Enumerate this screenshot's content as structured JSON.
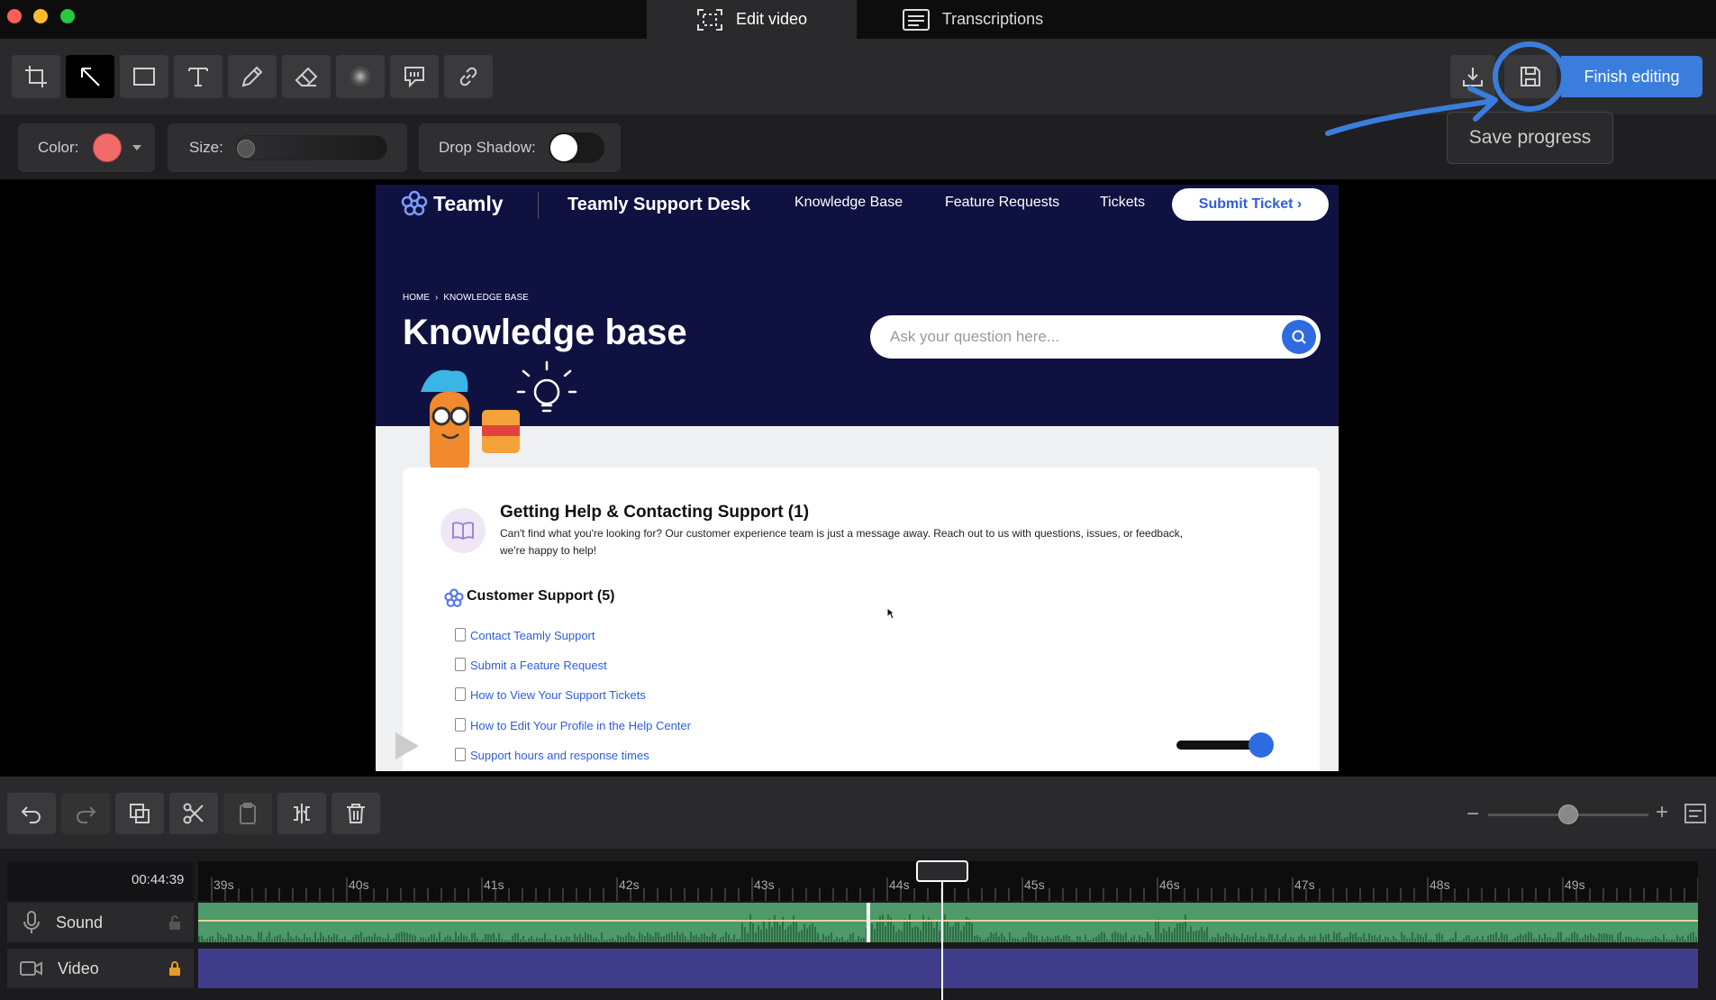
{
  "window": {
    "tabs": [
      {
        "label": "Edit video",
        "icon": "crop-frame-icon",
        "active": true
      },
      {
        "label": "Transcriptions",
        "icon": "transcript-icon",
        "active": false
      }
    ],
    "traffic_lights": {
      "close": "#ff5f57",
      "minimize": "#febc2e",
      "maximize": "#28c840"
    }
  },
  "toolbar": {
    "tools": [
      "crop-icon",
      "arrow-icon",
      "rectangle-icon",
      "text-icon",
      "pen-icon",
      "eraser-icon",
      "blur-icon",
      "callout-icon",
      "link-icon"
    ],
    "selected_tool": "arrow-icon",
    "finish_label": "Finish editing",
    "save_tooltip": "Save progress",
    "accent": "#3b7ddd"
  },
  "options": {
    "color_label": "Color:",
    "color_value": "#f26b6b",
    "size_label": "Size:",
    "shadow_label": "Drop Shadow:",
    "shadow_on": false
  },
  "video": {
    "brand": "Teamly",
    "site_title": "Teamly Support Desk",
    "nav": [
      "Knowledge Base",
      "Feature Requests",
      "Tickets"
    ],
    "submit_label": "Submit Ticket ›",
    "breadcrumb_home": "HOME",
    "breadcrumb_sep": "›",
    "breadcrumb_current": "KNOWLEDGE BASE",
    "page_heading": "Knowledge base",
    "search_placeholder": "Ask your question here...",
    "section_title": "Getting Help & Contacting Support (1)",
    "section_desc_1": "Can't find what you're looking for? Our customer experience team is just a message away. Reach out to us with questions, issues, or feedback,",
    "section_desc_2": "we're happy to help!",
    "category_title": "Customer Support (5)",
    "articles": [
      "Contact Teamly Support",
      "Submit a Feature Request",
      "How to View Your Support Tickets",
      "How to Edit Your Profile in the Help Center",
      "Support hours and response times"
    ],
    "hero_color": "#0f1240"
  },
  "timeline": {
    "current_time": "00:44:39",
    "ticks": [
      "39s",
      "40s",
      "41s",
      "42s",
      "43s",
      "44s",
      "45s",
      "46s",
      "47s",
      "48s",
      "49s"
    ],
    "tracks": [
      {
        "label": "Sound",
        "icon": "microphone-icon",
        "locked": false
      },
      {
        "label": "Video",
        "icon": "camera-icon",
        "locked": true
      }
    ],
    "zoom_minus": "−",
    "zoom_plus": "+",
    "sound_color": "#4e9a6a",
    "video_color": "#3f3d8a"
  }
}
